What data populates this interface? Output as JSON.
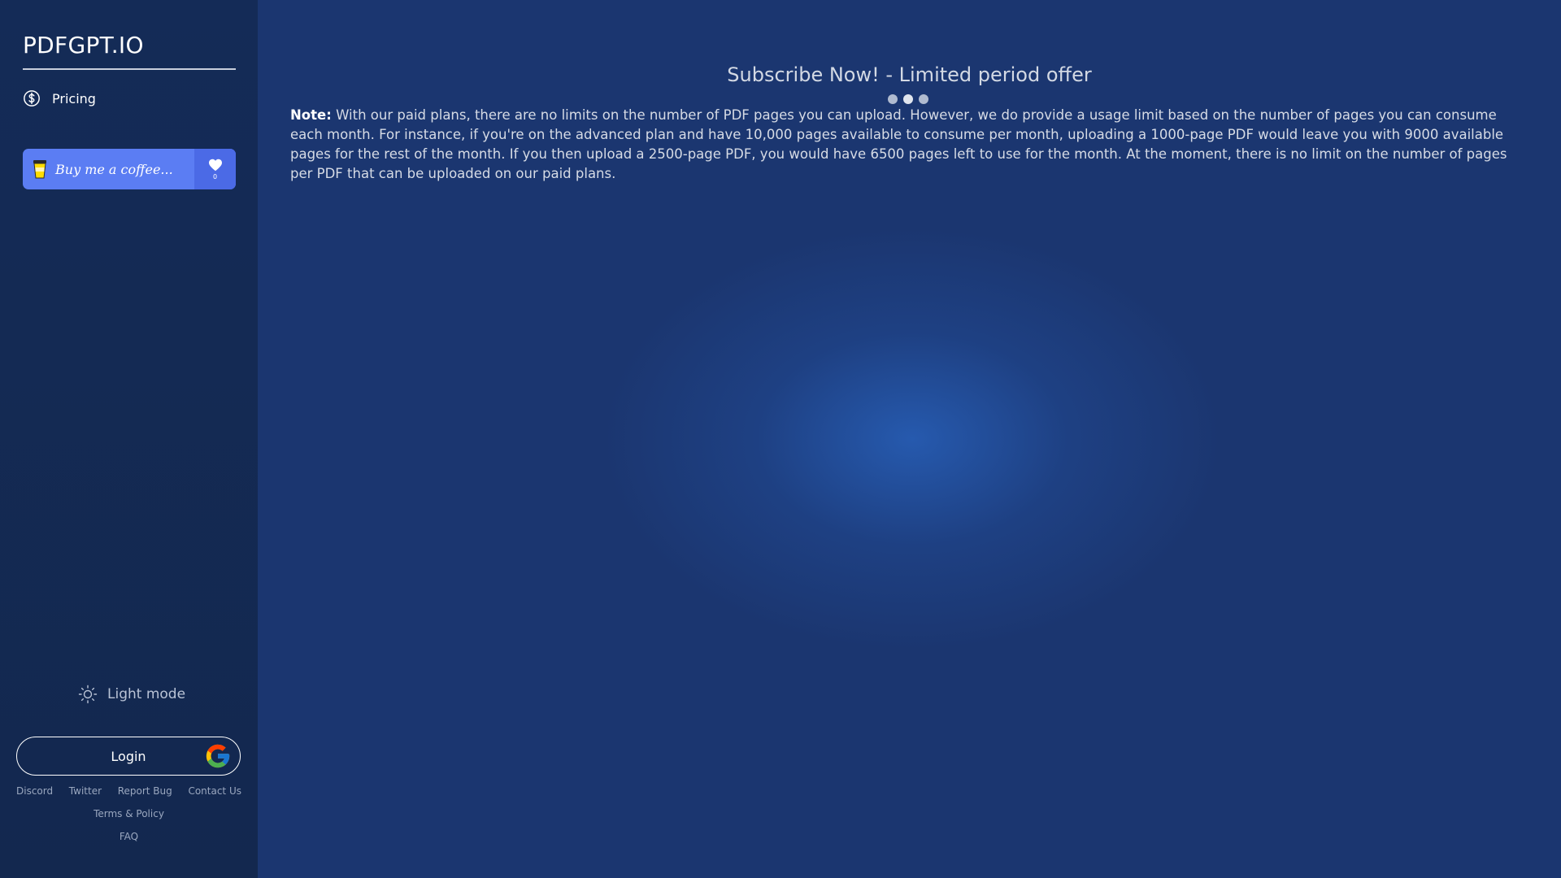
{
  "sidebar": {
    "logo": "PDFGPT.IO",
    "nav": {
      "pricing": {
        "label": "Pricing",
        "icon": "dollar-circle-icon"
      }
    },
    "coffee": {
      "label": "Buy me a coffee...",
      "count": "0",
      "icon": "coffee-cup-icon",
      "like_icon": "heart-icon",
      "bg_color": "#5b7df3"
    },
    "theme_toggle": {
      "label": "Light mode",
      "icon": "sun-icon"
    },
    "login": {
      "label": "Login",
      "icon": "google-icon"
    },
    "footer": {
      "discord": "Discord",
      "twitter": "Twitter",
      "report_bug": "Report Bug",
      "contact": "Contact Us",
      "terms": "Terms & Policy",
      "faq": "FAQ"
    }
  },
  "main": {
    "title": "Subscribe Now! - Limited period offer",
    "loading_indicator": "three-dots",
    "note": {
      "label": "Note:",
      "text": "With our paid plans, there are no limits on the number of PDF pages you can upload. However, we do provide a usage limit based on the number of pages you can consume each month. For instance, if you're on the advanced plan and have 10,000 pages available to consume per month, uploading a 1000-page PDF would leave you with 9000 available pages for the rest of the month. If you then upload a 2500-page PDF, you would have 6500 pages left to use for the month. At the moment, there is no limit on the number of pages per PDF that can be uploaded on our paid plans."
    },
    "bg_color": "#1b3670",
    "sidebar_color": "#142b57"
  }
}
